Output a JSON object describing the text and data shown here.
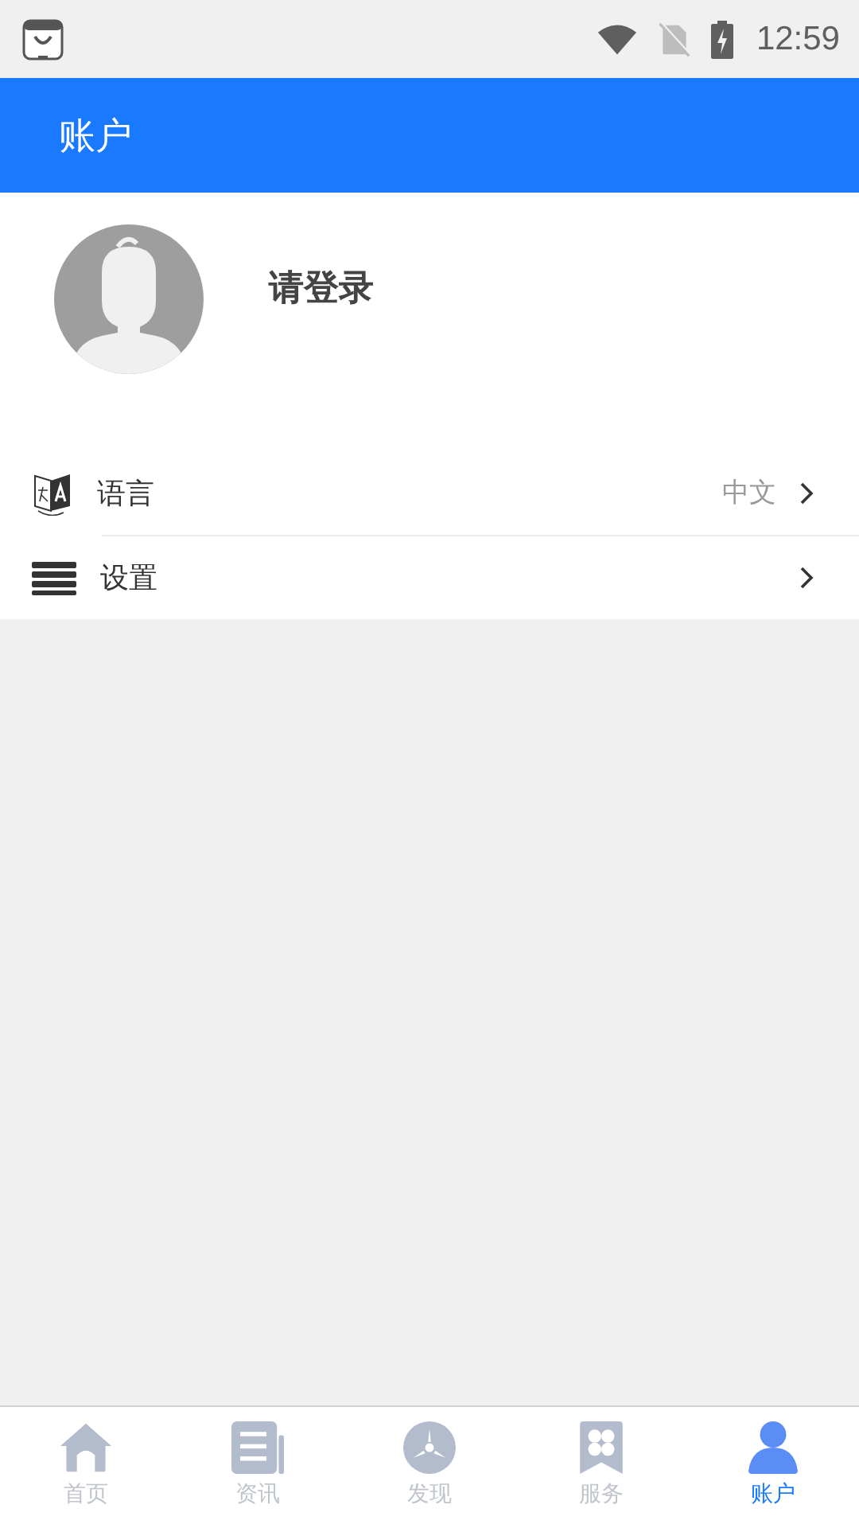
{
  "status_bar": {
    "time": "12:59"
  },
  "header": {
    "title": "账户"
  },
  "profile": {
    "login_prompt": "请登录"
  },
  "menu": [
    {
      "kind": "language",
      "label": "语言",
      "value": "中文"
    },
    {
      "kind": "settings",
      "label": "设置"
    }
  ],
  "tabs": [
    {
      "kind": "home",
      "label": "首页",
      "selected": false
    },
    {
      "kind": "news",
      "label": "资讯",
      "selected": false
    },
    {
      "kind": "discover",
      "label": "发现",
      "selected": false
    },
    {
      "kind": "services",
      "label": "服务",
      "selected": false
    },
    {
      "kind": "account",
      "label": "账户",
      "selected": true
    }
  ]
}
